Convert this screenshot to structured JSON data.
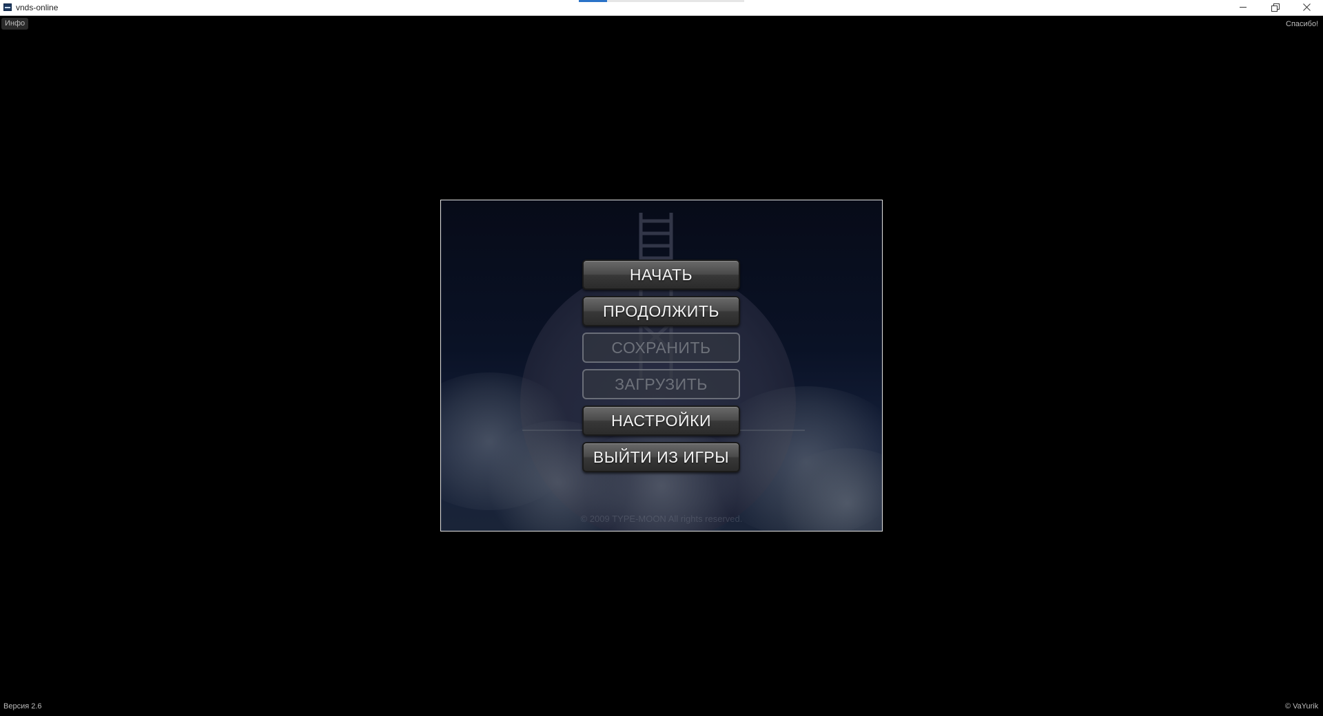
{
  "window": {
    "title": "vnds-online",
    "loading_progress": 0.17
  },
  "overlay": {
    "info_label": "Инфо",
    "thanks_label": "Спасибо!",
    "version_label": "Версия 2.6",
    "author_label": "© VaYurik"
  },
  "game": {
    "copyright_text": "© 2009 TYPE-MOON All rights reserved.",
    "menu": [
      {
        "label": "НАЧАТЬ",
        "enabled": true
      },
      {
        "label": "ПРОДОЛЖИТЬ",
        "enabled": true
      },
      {
        "label": "СОХРАНИТЬ",
        "enabled": false
      },
      {
        "label": "ЗАГРУЗИТЬ",
        "enabled": false
      },
      {
        "label": "НАСТРОЙКИ",
        "enabled": true
      },
      {
        "label": "ВЫЙТИ ИЗ ИГРЫ",
        "enabled": true
      }
    ]
  }
}
